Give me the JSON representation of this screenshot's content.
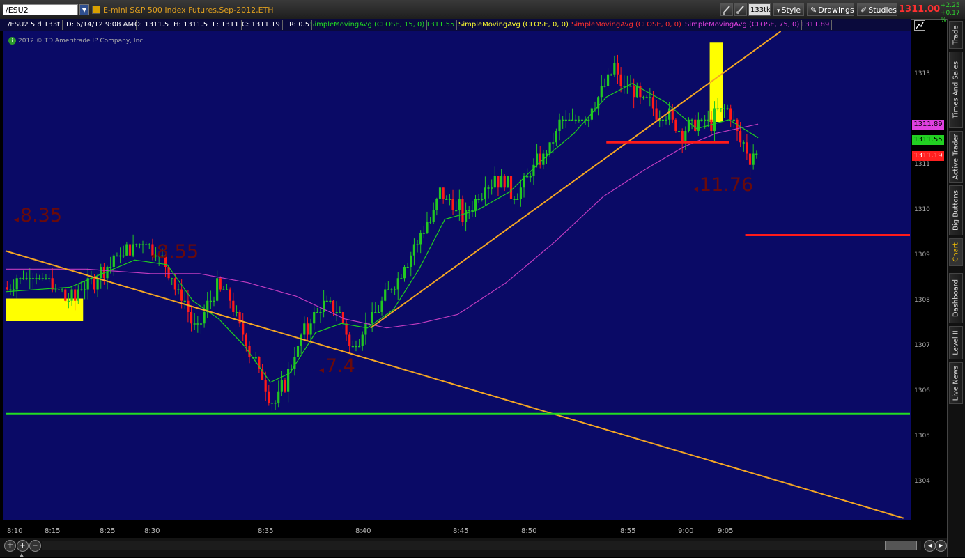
{
  "toolbar": {
    "symbol": "/ESU2",
    "instrument_title": "E-mini S&P 500 Index Futures,Sep-2012,ETH",
    "aggregation_badge": "133tk",
    "style_label": "Style",
    "drawings_label": "Drawings",
    "studies_label": "Studies",
    "last_price": "1311.00",
    "change_abs": "+2.25",
    "change_pct": "+0.17 %"
  },
  "info_bar": {
    "symbol_period": "/ESU2 5 d 133t",
    "date": "D: 6/14/12 9:08 AM",
    "open": "O: 1311.5",
    "high": "H: 1311.5",
    "low": "L: 1311",
    "close": "C: 1311.19",
    "range": "R: 0.5",
    "sma15_label": "SimpleMovingAvg (CLOSE, 15, 0)",
    "sma15_value": "1311.55",
    "sma0a_label": "SimpleMovingAvg (CLOSE, 0, 0)",
    "sma0b_label": "SimpleMovingAvg (CLOSE, 0, 0)",
    "sma75_label": "SimpleMovingAvg (CLOSE, 75, 0)",
    "sma75_value": "1311.89"
  },
  "copyright": "2012 © TD Ameritrade IP Company, Inc.",
  "price_labels": {
    "sma75": "1311.89",
    "sma15": "1311.55",
    "close": "1311.19"
  },
  "annotations": [
    "8.35",
    "8.55",
    "7.4",
    "11.76"
  ],
  "sidebar_tabs": [
    "Trade",
    "Times And Sales",
    "Active Trader",
    "Big Buttons",
    "Chart",
    "Dashboard",
    "Level II",
    "Live News"
  ],
  "colors": {
    "background": "#0a0a66",
    "up": "#22c822",
    "down": "#ff1a1a",
    "sma15": "#1ed01e",
    "sma75": "#c03cc0",
    "trendline": "#f5a623",
    "support": "#22dd22",
    "marker": "#ffff00"
  },
  "chart_data": {
    "type": "candlestick",
    "title": "E-mini S&P 500 Index Futures,Sep-2012,ETH",
    "ylim": [
      1303.15,
      1313.95
    ],
    "y_ticks": [
      1304,
      1305,
      1306,
      1307,
      1308,
      1309,
      1310,
      1311,
      1313
    ],
    "x_ticks": [
      "8:10",
      "8:15",
      "8:25",
      "8:30",
      "8:35",
      "8:40",
      "8:45",
      "8:50",
      "8:55",
      "9:00",
      "9:05"
    ],
    "grid": false,
    "close_path": [
      [
        0,
        1308.3
      ],
      [
        8,
        1308.6
      ],
      [
        14,
        1308.3
      ],
      [
        20,
        1308.0
      ],
      [
        27,
        1308.5
      ],
      [
        33,
        1308.9
      ],
      [
        40,
        1309.2
      ],
      [
        45,
        1309.3
      ],
      [
        50,
        1308.7
      ],
      [
        55,
        1308.0
      ],
      [
        59,
        1307.2
      ],
      [
        62,
        1307.8
      ],
      [
        66,
        1308.3
      ],
      [
        70,
        1308.0
      ],
      [
        75,
        1307.0
      ],
      [
        80,
        1306.2
      ],
      [
        83,
        1305.6
      ],
      [
        86,
        1306.1
      ],
      [
        90,
        1306.9
      ],
      [
        95,
        1307.6
      ],
      [
        99,
        1308.0
      ],
      [
        103,
        1307.7
      ],
      [
        107,
        1307.0
      ],
      [
        110,
        1307.3
      ],
      [
        115,
        1307.8
      ],
      [
        120,
        1308.4
      ],
      [
        126,
        1309.1
      ],
      [
        131,
        1309.8
      ],
      [
        135,
        1310.4
      ],
      [
        139,
        1310.0
      ],
      [
        143,
        1309.9
      ],
      [
        146,
        1310.3
      ],
      [
        150,
        1310.7
      ],
      [
        155,
        1310.6
      ],
      [
        158,
        1310.2
      ],
      [
        162,
        1310.8
      ],
      [
        167,
        1311.2
      ],
      [
        171,
        1311.8
      ],
      [
        176,
        1312.0
      ],
      [
        180,
        1312.1
      ],
      [
        184,
        1312.6
      ],
      [
        188,
        1313.2
      ],
      [
        191,
        1312.8
      ],
      [
        195,
        1312.5
      ],
      [
        200,
        1312.3
      ],
      [
        205,
        1312.1
      ],
      [
        210,
        1311.7
      ],
      [
        215,
        1311.9
      ],
      [
        219,
        1312.0
      ],
      [
        223,
        1312.2
      ],
      [
        226,
        1311.9
      ],
      [
        229,
        1311.3
      ],
      [
        233,
        1311.1
      ]
    ],
    "sma15_path": [
      [
        0,
        1308.2
      ],
      [
        20,
        1308.3
      ],
      [
        40,
        1308.9
      ],
      [
        50,
        1308.8
      ],
      [
        58,
        1308.0
      ],
      [
        66,
        1307.6
      ],
      [
        74,
        1307.0
      ],
      [
        82,
        1306.2
      ],
      [
        88,
        1306.4
      ],
      [
        96,
        1307.3
      ],
      [
        104,
        1307.5
      ],
      [
        112,
        1307.4
      ],
      [
        120,
        1307.8
      ],
      [
        128,
        1308.7
      ],
      [
        136,
        1309.8
      ],
      [
        146,
        1310.0
      ],
      [
        156,
        1310.4
      ],
      [
        166,
        1311.1
      ],
      [
        176,
        1311.7
      ],
      [
        186,
        1312.5
      ],
      [
        194,
        1312.8
      ],
      [
        204,
        1312.4
      ],
      [
        214,
        1311.8
      ],
      [
        224,
        1312.0
      ],
      [
        233,
        1311.6
      ]
    ],
    "sma75_path": [
      [
        0,
        1308.7
      ],
      [
        25,
        1308.7
      ],
      [
        45,
        1308.6
      ],
      [
        60,
        1308.6
      ],
      [
        75,
        1308.4
      ],
      [
        90,
        1308.1
      ],
      [
        105,
        1307.6
      ],
      [
        118,
        1307.4
      ],
      [
        128,
        1307.5
      ],
      [
        140,
        1307.7
      ],
      [
        155,
        1308.4
      ],
      [
        170,
        1309.3
      ],
      [
        185,
        1310.3
      ],
      [
        198,
        1310.9
      ],
      [
        210,
        1311.4
      ],
      [
        220,
        1311.7
      ],
      [
        233,
        1311.9
      ]
    ],
    "horizontal_lines": [
      {
        "price": 1305.5,
        "from_t": 0,
        "to_t": 280,
        "role": "support"
      },
      {
        "price": 1311.5,
        "from_t": 186,
        "to_t": 224,
        "role": "marker"
      },
      {
        "price": 1309.45,
        "from_t": 229,
        "to_t": 280,
        "role": "marker"
      }
    ],
    "trendlines": [
      {
        "from": [
          0,
          1309.1
        ],
        "to": [
          278,
          1303.2
        ]
      },
      {
        "from": [
          113,
          1307.4
        ],
        "to": [
          240,
          1313.95
        ]
      }
    ],
    "highlight_boxes": [
      {
        "t_from": 0,
        "t_to": 24,
        "price_low": 1307.55,
        "price_high": 1308.05
      },
      {
        "t_from": 218,
        "t_to": 222,
        "price_low": 1311.95,
        "price_high": 1313.7
      }
    ],
    "annotation_points": [
      {
        "text": "8.35",
        "t": 4,
        "price": 1310.3
      },
      {
        "text": "8.55",
        "t": 49,
        "price": 1309.25
      },
      {
        "text": "7.4",
        "t": 105,
        "price": 1306.95
      },
      {
        "text": "11.76",
        "t": 227,
        "price": 1310.95
      }
    ],
    "t_max": 280
  }
}
